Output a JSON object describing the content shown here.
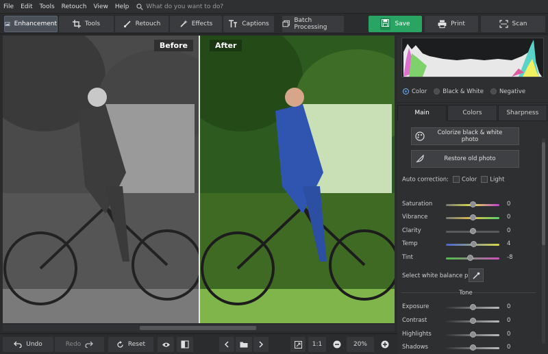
{
  "menu": {
    "items": [
      "File",
      "Edit",
      "Tools",
      "Retouch",
      "View",
      "Help"
    ],
    "search_placeholder": "What do you want to do?"
  },
  "toolbar": {
    "enhancement": "Enhancement",
    "tools": "Tools",
    "retouch": "Retouch",
    "effects": "Effects",
    "captions": "Captions",
    "batch": "Batch Processing",
    "save": "Save",
    "print": "Print",
    "scan": "Scan"
  },
  "canvas": {
    "before_label": "Before",
    "after_label": "After"
  },
  "panel": {
    "color_modes": [
      {
        "label": "Color",
        "selected": true
      },
      {
        "label": "Black & White",
        "selected": false
      },
      {
        "label": "Negative",
        "selected": false
      }
    ],
    "tabs": [
      "Main",
      "Colors",
      "Sharpness"
    ],
    "colorize_button": "Colorize black & white photo",
    "restore_button": "Restore old photo",
    "auto_correction": {
      "label": "Auto correction:",
      "options": [
        "Color",
        "Light"
      ]
    },
    "sliders": [
      {
        "label": "Saturation",
        "value": "0",
        "level": 0.5
      },
      {
        "label": "Vibrance",
        "value": "0",
        "level": 0.5
      },
      {
        "label": "Clarity",
        "value": "0",
        "level": 0.5
      },
      {
        "label": "Temp",
        "value": "4",
        "level": 0.52
      },
      {
        "label": "Tint",
        "value": "-8",
        "level": 0.46
      }
    ],
    "white_balance_label": "Select white balance point",
    "tone_header": "Tone",
    "tone_sliders": [
      {
        "label": "Exposure",
        "value": "0",
        "level": 0.5
      },
      {
        "label": "Contrast",
        "value": "0",
        "level": 0.5
      },
      {
        "label": "Highlights",
        "value": "0",
        "level": 0.5
      },
      {
        "label": "Shadows",
        "value": "0",
        "level": 0.5
      }
    ]
  },
  "bottom": {
    "undo": "Undo",
    "redo": "Redo",
    "reset": "Reset",
    "ratio": "1:1",
    "zoom": "20%"
  },
  "colors": {
    "accent_green": "#29a463",
    "radio_blue": "#3b8ee0"
  }
}
